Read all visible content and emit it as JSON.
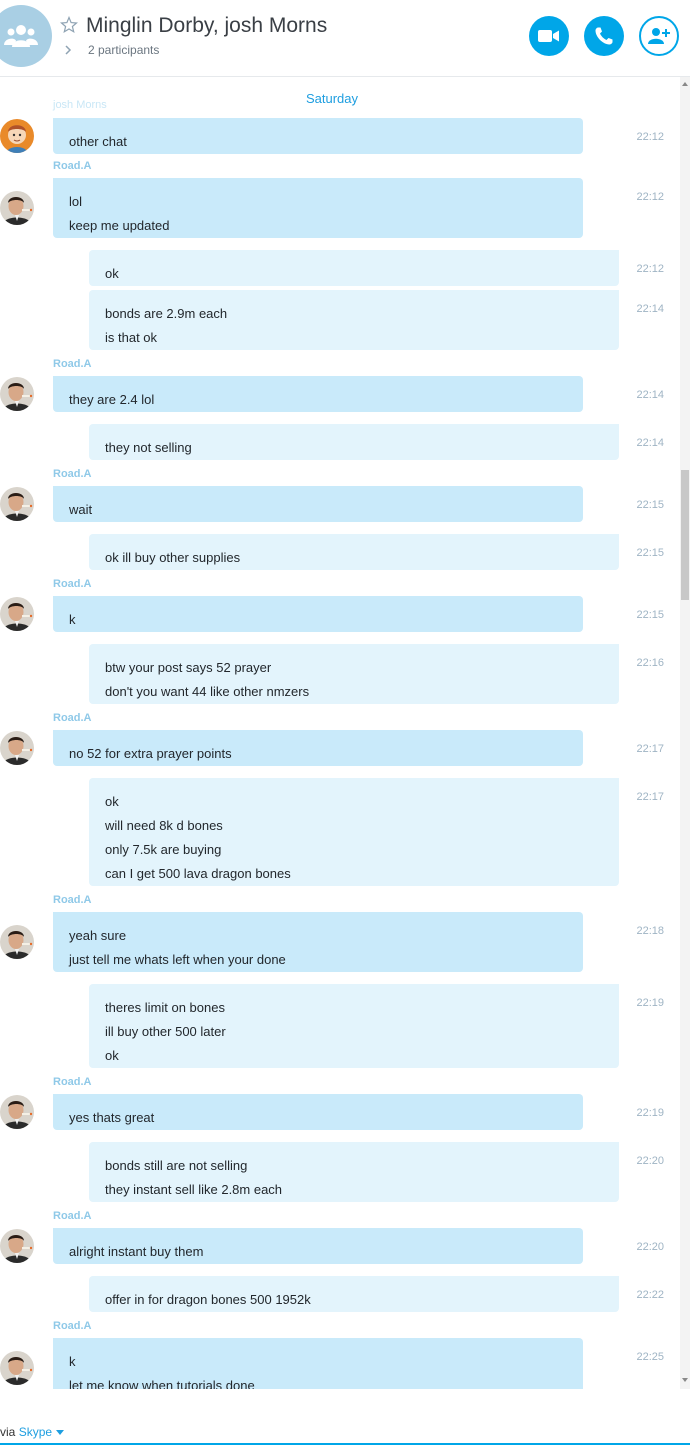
{
  "header": {
    "title": "Minglin Dorby, josh Morns",
    "participants": "2 participants"
  },
  "chat": {
    "date_label": "Saturday",
    "faded_name": "josh Morns",
    "sender_name": "Road.A",
    "messages": [
      {
        "dir": "in",
        "avatar": "cartoon-avatar",
        "lines": [
          "other chat"
        ],
        "time": "22:12"
      },
      {
        "dir": "in",
        "avatar": "photo-avatar",
        "sender": "Road.A",
        "lines": [
          "lol",
          "keep me updated"
        ],
        "time": "22:12"
      },
      {
        "dir": "out",
        "lines": [
          "ok"
        ],
        "time": "22:12"
      },
      {
        "dir": "out",
        "lines": [
          "bonds are 2.9m each",
          "is that ok"
        ],
        "time": "22:14"
      },
      {
        "dir": "in",
        "avatar": "photo-avatar",
        "sender": "Road.A",
        "lines": [
          "they are 2.4 lol"
        ],
        "time": "22:14"
      },
      {
        "dir": "out",
        "lines": [
          "they not selling"
        ],
        "time": "22:14"
      },
      {
        "dir": "in",
        "avatar": "photo-avatar",
        "sender": "Road.A",
        "lines": [
          "wait"
        ],
        "time": "22:15"
      },
      {
        "dir": "out",
        "lines": [
          "ok ill buy other supplies"
        ],
        "time": "22:15"
      },
      {
        "dir": "in",
        "avatar": "photo-avatar",
        "sender": "Road.A",
        "lines": [
          "k"
        ],
        "time": "22:15"
      },
      {
        "dir": "out",
        "lines": [
          "btw your post says 52 prayer",
          "don't you want 44 like other nmzers"
        ],
        "time": "22:16"
      },
      {
        "dir": "in",
        "avatar": "photo-avatar",
        "sender": "Road.A",
        "lines": [
          "no 52 for extra prayer points"
        ],
        "time": "22:17"
      },
      {
        "dir": "out",
        "lines": [
          "ok",
          "will need 8k d bones",
          "only 7.5k are buying",
          "can I get 500 lava dragon bones"
        ],
        "time": "22:17"
      },
      {
        "dir": "in",
        "avatar": "photo-avatar",
        "sender": "Road.A",
        "lines": [
          "yeah sure",
          "just tell me whats left when your done"
        ],
        "time": "22:18"
      },
      {
        "dir": "out",
        "lines": [
          "theres limit on bones",
          "ill buy other 500 later",
          "ok"
        ],
        "time": "22:19"
      },
      {
        "dir": "in",
        "avatar": "photo-avatar",
        "sender": "Road.A",
        "lines": [
          "yes thats great"
        ],
        "time": "22:19"
      },
      {
        "dir": "out",
        "lines": [
          "bonds still are not selling",
          "they instant sell like 2.8m each"
        ],
        "time": "22:20"
      },
      {
        "dir": "in",
        "avatar": "photo-avatar",
        "sender": "Road.A",
        "lines": [
          "alright instant buy them"
        ],
        "time": "22:20"
      },
      {
        "dir": "out",
        "lines": [
          "offer in for dragon bones 500 1952k"
        ],
        "time": "22:22"
      },
      {
        "dir": "in",
        "avatar": "photo-avatar",
        "sender": "Road.A",
        "lines": [
          "k",
          "let me know when tutorials done"
        ],
        "time": "22:25"
      }
    ]
  },
  "footer": {
    "via_label": "via",
    "skype_label": "Skype"
  },
  "colors": {
    "accent": "#00a6e8",
    "incoming_bubble": "#c9eafa",
    "outgoing_bubble": "#e3f4fc"
  }
}
